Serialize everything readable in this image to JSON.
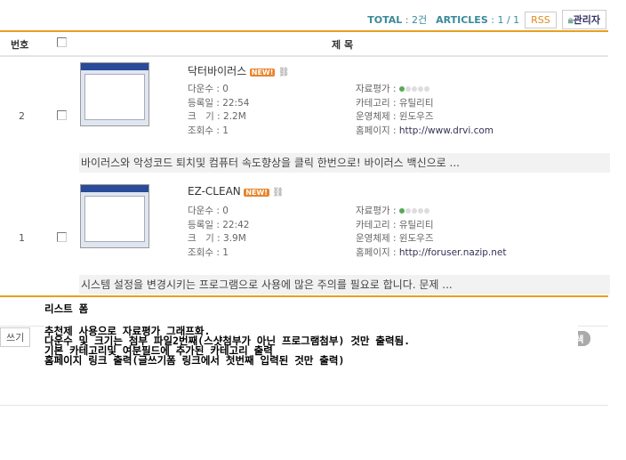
{
  "header": {
    "total_label": "TOTAL",
    "total_value": "2건",
    "articles_label": "ARTICLES",
    "articles_value": "1 / 1",
    "rss": "RSS",
    "admin": "관리자"
  },
  "columns": {
    "number": "번호",
    "title": "제 목"
  },
  "posts": [
    {
      "number": "2",
      "title": "닥터바이러스",
      "badge": "NEW!",
      "downloads": "다운수 : 0",
      "date": "등록일 : 22:54",
      "size": "크　기 : 2.2M",
      "views": "조회수 : 1",
      "rating_label": "자료평가 :",
      "rating": 1,
      "category": "카테고리 : 유틸리티",
      "os": "운영체제 : 윈도우즈",
      "homepage_label": "홈페이지 :",
      "homepage": "http://www.drvi.com",
      "description": "바이러스와 악성코드 퇴치및 컴퓨터 속도향상을 클릭 한번으로! 바이러스 백신으로 ..."
    },
    {
      "number": "1",
      "title": "EZ-CLEAN",
      "badge": "NEW!",
      "downloads": "다운수 : 0",
      "date": "등록일 : 22:42",
      "size": "크　기 : 3.9M",
      "views": "조회수 : 1",
      "rating_label": "자료평가 :",
      "rating": 1,
      "category": "카테고리 : 유틸리티",
      "os": "운영체제 : 윈도우즈",
      "homepage_label": "홈페이지 :",
      "homepage": "http://foruser.nazip.net",
      "description": "시스템 설정을 변경시키는 프로그램으로 사용에 많은 주의를 필요로 합니다. 문제 ..."
    }
  ],
  "footer": {
    "write": "쓰기",
    "search": "검색"
  },
  "popup": {
    "title": "리스트 폼",
    "lines": [
      "추천제 사용으로 자료평가 그래프화.",
      "다운수 및 크기는 첨부 파일2번째(스샷첨부가 아닌 프로그램첨부) 것만 출력됨.",
      "기본 카테고리및 여분필드에 추가된 카테고리 출력",
      "홈페이지 링크 출력(글쓰기폼 링크에서 첫번째 입력된 것만 출력)"
    ]
  }
}
